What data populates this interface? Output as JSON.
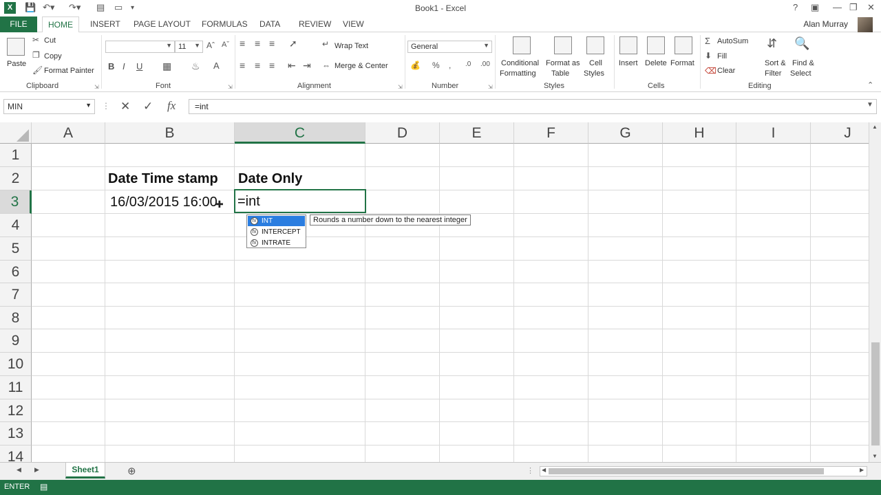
{
  "window": {
    "title": "Book1 - Excel",
    "user": "Alan Murray"
  },
  "qat": {
    "save_icon": "save-icon",
    "undo_icon": "undo-icon",
    "redo_icon": "redo-icon"
  },
  "tabs": [
    "FILE",
    "HOME",
    "INSERT",
    "PAGE LAYOUT",
    "FORMULAS",
    "DATA",
    "REVIEW",
    "VIEW"
  ],
  "ribbon": {
    "clipboard": {
      "paste": "Paste",
      "cut": "Cut",
      "copy": "Copy",
      "format_painter": "Format Painter",
      "label": "Clipboard"
    },
    "font": {
      "font_name": "",
      "font_size": "11",
      "label": "Font"
    },
    "alignment": {
      "wrap_text": "Wrap Text",
      "merge_center": "Merge & Center",
      "label": "Alignment"
    },
    "number": {
      "format": "General",
      "label": "Number"
    },
    "styles": {
      "conditional_1": "Conditional",
      "conditional_2": "Formatting",
      "format_table_1": "Format as",
      "format_table_2": "Table",
      "cell_styles_1": "Cell",
      "cell_styles_2": "Styles",
      "label": "Styles"
    },
    "cells": {
      "insert": "Insert",
      "delete": "Delete",
      "format": "Format",
      "label": "Cells"
    },
    "editing": {
      "autosum": "AutoSum",
      "fill": "Fill",
      "clear": "Clear",
      "sort_1": "Sort &",
      "sort_2": "Filter",
      "find_1": "Find &",
      "find_2": "Select",
      "label": "Editing"
    }
  },
  "formula_bar": {
    "name_box": "MIN",
    "formula": "=int"
  },
  "columns": [
    "A",
    "B",
    "C",
    "D",
    "E",
    "F",
    "G",
    "H",
    "I",
    "J"
  ],
  "rows": [
    "1",
    "2",
    "3",
    "4",
    "5",
    "6",
    "7",
    "8",
    "9",
    "10",
    "11",
    "12",
    "13",
    "14"
  ],
  "cells": {
    "B2": "Date Time stamp",
    "C2": "Date Only",
    "B3": "16/03/2015 16:00",
    "C3": "=int"
  },
  "autocomplete": {
    "items": [
      "INT",
      "INTERCEPT",
      "INTRATE"
    ],
    "tooltip": "Rounds a number down to the nearest integer"
  },
  "sheets": [
    "Sheet1"
  ],
  "status": {
    "mode": "ENTER"
  },
  "colors": {
    "accent": "#217346",
    "selection": "#2a7de0"
  }
}
